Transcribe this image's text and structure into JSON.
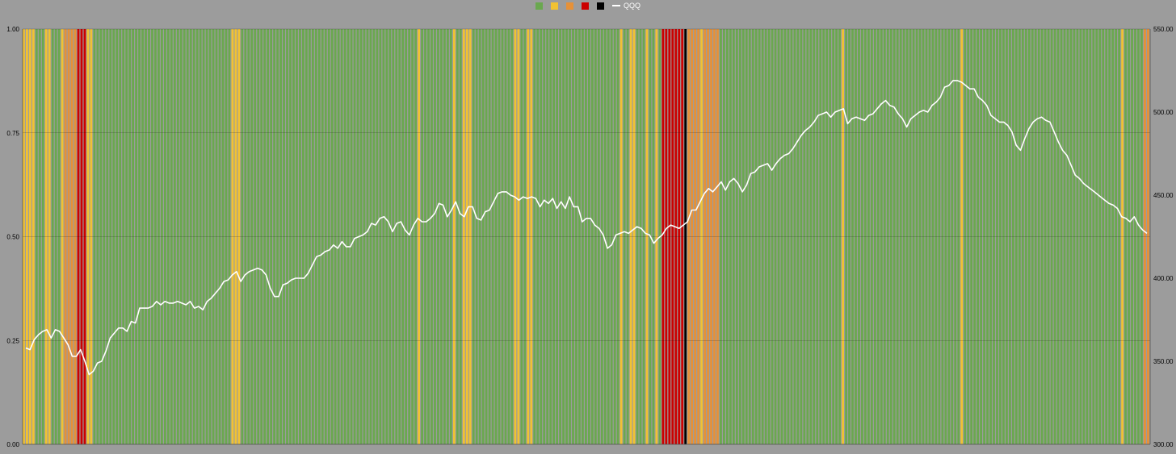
{
  "colors": {
    "green": "#6aa84f",
    "yellow": "#f1c232",
    "orange": "#e69138",
    "red": "#cc0000",
    "black": "#000000",
    "line": "#ffffff",
    "background": "#9c9c9c"
  },
  "chart_data": {
    "type": "bar",
    "title": "",
    "grid": true,
    "legend_position": "top-center",
    "legend": [
      {
        "label": "",
        "color": "#6aa84f"
      },
      {
        "label": "",
        "color": "#f1c232"
      },
      {
        "label": "",
        "color": "#e69138"
      },
      {
        "label": "",
        "color": "#cc0000"
      },
      {
        "label": "",
        "color": "#000000"
      },
      {
        "label": "QQQ",
        "color": "#ffffff",
        "kind": "line"
      }
    ],
    "y_left": {
      "ylim": [
        0,
        1
      ],
      "ticks": [
        "0.00",
        "0.25",
        "0.50",
        "0.75",
        "1.00"
      ]
    },
    "y_right": {
      "ylim": [
        300,
        550
      ],
      "ticks": [
        "300.00",
        "350.00",
        "400.00",
        "450.00",
        "500.00",
        "550.00"
      ]
    },
    "regimes": "yyyygggyygggyoooorrryygggggggggggggggggggggggggggggggggggggggggggyyygggggggggggggggggggggggggggggggggggggggggggggggggggggggyggggggggggyggyyygggggggggggggyyggyygggggggggggggggggggggggggggyggyygggyggygrrrrrrrbooooyoooooggggggggggggggggggggggggggggggggggggggyggggggggggggggggggggggggggggggggggggygggggggggggggggggggggggggggggggggggggggggggggggggyggggggoo",
    "series": [
      {
        "name": "QQQ",
        "axis": "right",
        "values": [
          358,
          357,
          363,
          366,
          368,
          369,
          364,
          369,
          368,
          364,
          360,
          353,
          353,
          357,
          350,
          342,
          344,
          349,
          350,
          356,
          364,
          367,
          370,
          370,
          368,
          374,
          373,
          382,
          382,
          382,
          383,
          386,
          384,
          386,
          385,
          385,
          386,
          385,
          384,
          386,
          382,
          383,
          381,
          386,
          388,
          391,
          394,
          398,
          399,
          402,
          404,
          398,
          402,
          404,
          405,
          406,
          405,
          402,
          394,
          389,
          389,
          396,
          397,
          399,
          400,
          400,
          400,
          403,
          408,
          413,
          414,
          416,
          417,
          420,
          418,
          422,
          419,
          419,
          424,
          425,
          426,
          428,
          433,
          432,
          436,
          437,
          434,
          428,
          433,
          434,
          429,
          426,
          432,
          436,
          434,
          434,
          436,
          439,
          445,
          444,
          437,
          441,
          446,
          439,
          437,
          443,
          443,
          436,
          435,
          440,
          441,
          446,
          451,
          452,
          452,
          450,
          449,
          447,
          449,
          448,
          449,
          448,
          443,
          447,
          445,
          448,
          442,
          446,
          442,
          449,
          443,
          443,
          434,
          436,
          436,
          432,
          430,
          426,
          418,
          420,
          426,
          427,
          428,
          427,
          429,
          431,
          430,
          427,
          426,
          421,
          424,
          426,
          430,
          432,
          431,
          430,
          432,
          434,
          441,
          441,
          446,
          451,
          454,
          452,
          455,
          458,
          453,
          458,
          460,
          457,
          452,
          456,
          463,
          464,
          467,
          468,
          469,
          465,
          469,
          472,
          474,
          475,
          478,
          482,
          486,
          489,
          491,
          494,
          498,
          499,
          500,
          497,
          500,
          501,
          502,
          493,
          496,
          497,
          496,
          495,
          498,
          499,
          502,
          505,
          507,
          504,
          503,
          499,
          496,
          491,
          496,
          498,
          500,
          501,
          500,
          504,
          506,
          509,
          515,
          516,
          519,
          519,
          518,
          516,
          514,
          514,
          509,
          507,
          504,
          498,
          496,
          494,
          494,
          492,
          488,
          480,
          477,
          484,
          490,
          494,
          496,
          497,
          495,
          494,
          488,
          482,
          477,
          474,
          468,
          462,
          460,
          457,
          455,
          453,
          451,
          449,
          447,
          445,
          444,
          442,
          437,
          436,
          434,
          437,
          432,
          429,
          427
        ]
      }
    ]
  }
}
